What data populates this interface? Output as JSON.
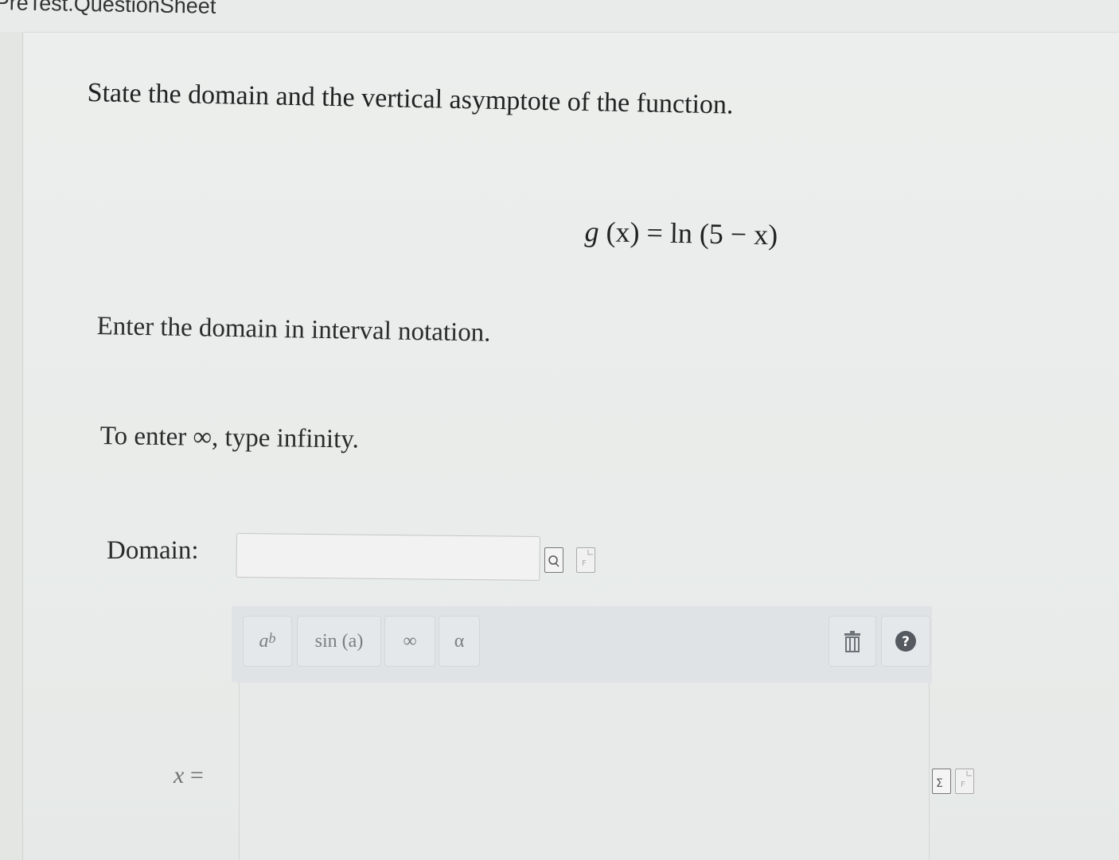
{
  "header": {
    "breadcrumb": "PreTest.QuestionSheet"
  },
  "question": {
    "stem": "State the domain and the vertical asymptote of the function.",
    "function_lhs": "g",
    "function_arg": "(x)",
    "function_eq": "=",
    "function_rhs": "ln (5 − x)",
    "domain_instruction": "Enter the domain in interval notation.",
    "infinity_hint": "To enter ∞, type infinity."
  },
  "domain_field": {
    "label": "Domain:",
    "value": "",
    "placeholder": ""
  },
  "toolbar": {
    "power_base": "a",
    "power_exp": "b",
    "sin_label": "sin (a)",
    "infinity_label": "∞",
    "alpha_label": "α",
    "trash_icon": "trash-icon",
    "help_icon": "help-icon",
    "help_label": "?"
  },
  "asymptote_field": {
    "variable": "x",
    "equals": "=",
    "value": ""
  },
  "colors": {
    "page_bg": "#e9ecea",
    "toolbar_bg": "#dfe3e6",
    "help_circle": "#555a60",
    "text": "#222222"
  }
}
